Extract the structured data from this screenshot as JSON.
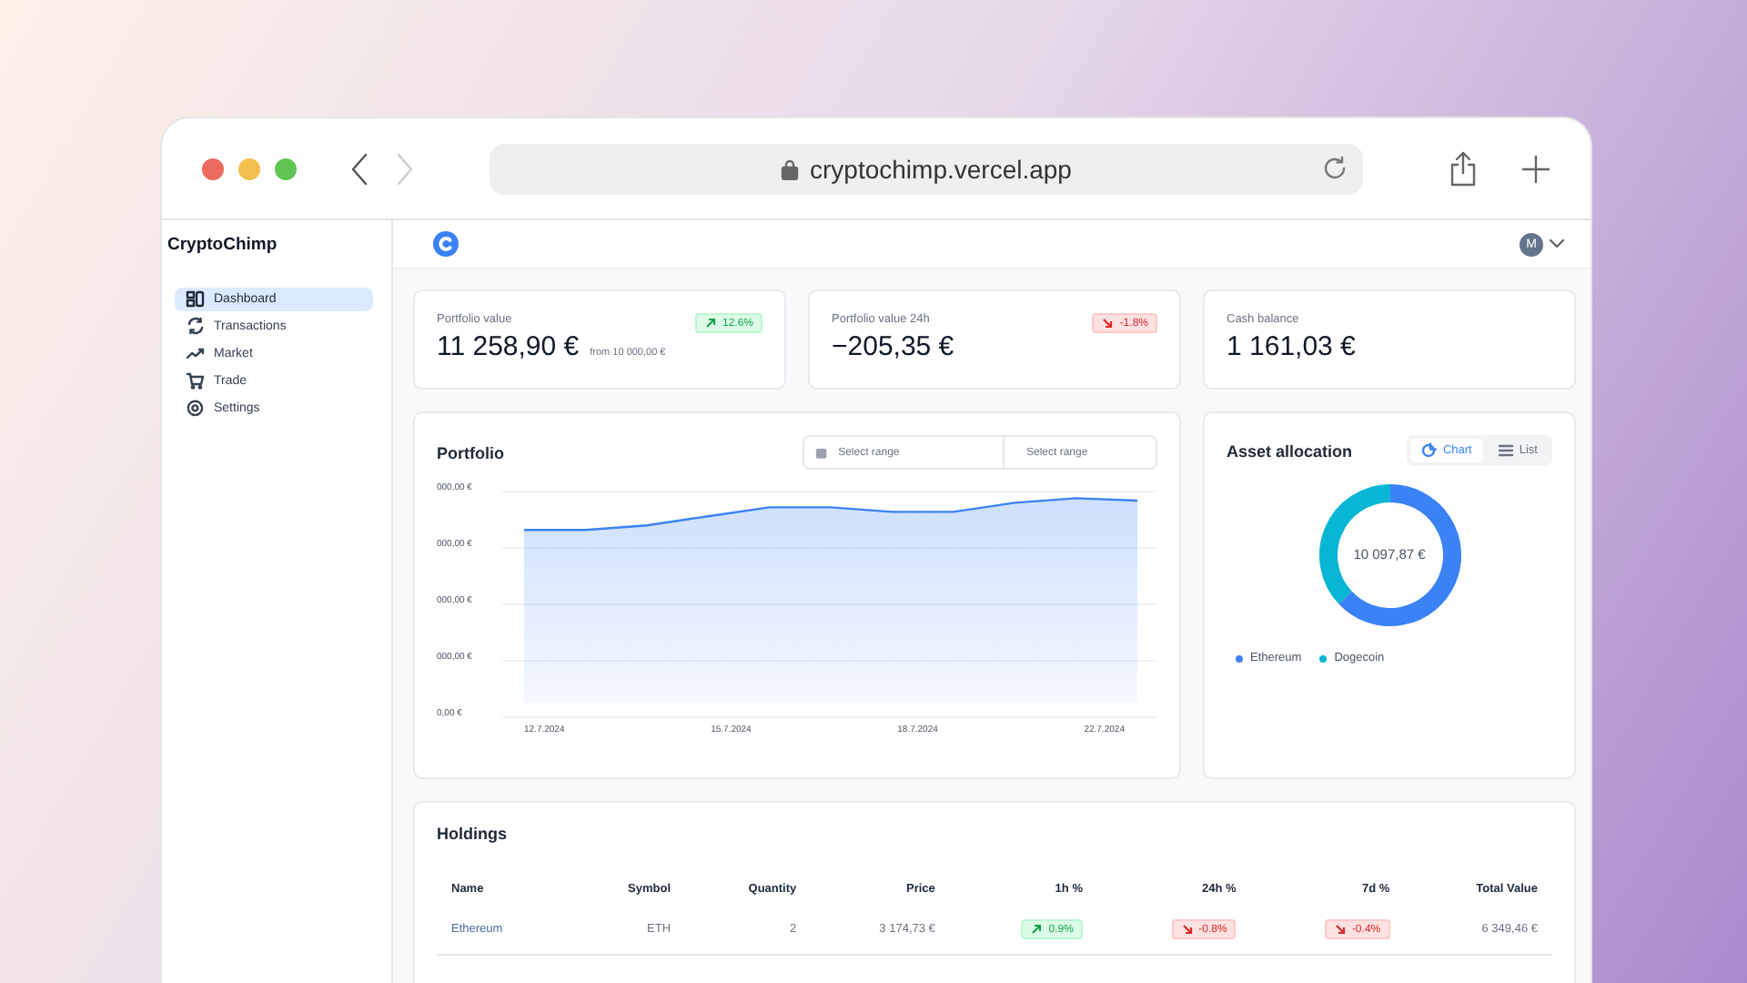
{
  "browser": {
    "url": "cryptochimp.vercel.app"
  },
  "sidebar": {
    "brand": "CryptoChimp",
    "items": [
      {
        "label": "Dashboard",
        "kind": "dashboard",
        "selected": true
      },
      {
        "label": "Transactions",
        "kind": "transactions",
        "selected": false
      },
      {
        "label": "Market",
        "kind": "market",
        "selected": false
      },
      {
        "label": "Trade",
        "kind": "trade",
        "selected": false
      },
      {
        "label": "Settings",
        "kind": "settings",
        "selected": false
      }
    ]
  },
  "header": {
    "avatar": "M"
  },
  "stats": [
    {
      "label": "Portfolio value",
      "value": "11 258,90 €",
      "note": "from 10 000,00 €",
      "change": {
        "text": "12.6%",
        "rising": true
      }
    },
    {
      "label": "Portfolio value 24h",
      "value": "−205,35 €",
      "change": {
        "text": "-1.8%",
        "rising": false
      }
    },
    {
      "label": "Cash balance",
      "value": "1 161,03 €"
    }
  ],
  "portfolio": {
    "title": "Portfolio",
    "range_start": {
      "placeholder": "Select range"
    },
    "range_end": {
      "placeholder": "Select range"
    },
    "y_ticks": [
      "000,00 €",
      "000,00 €",
      "000,00 €",
      "000,00 €",
      "0,00 €"
    ],
    "x_ticks": [
      "12.7.2024",
      "15.7.2024",
      "18.7.2024",
      "22.7.2024"
    ]
  },
  "allocation": {
    "title": "Asset allocation",
    "views": [
      {
        "label": "Chart",
        "kind": "chart",
        "selected": true
      },
      {
        "label": "List",
        "kind": "list",
        "selected": false
      }
    ],
    "total": "10 097,87 €",
    "assets": [
      {
        "name": "Ethereum",
        "color": "#3b82f6"
      },
      {
        "name": "Dogecoin",
        "color": "#06b6d4"
      }
    ]
  },
  "holdings": {
    "title": "Holdings",
    "columns": [
      "Name",
      "Symbol",
      "Quantity",
      "Price",
      "1h %",
      "24h %",
      "7d %",
      "Total Value"
    ],
    "rows": [
      {
        "name": "Ethereum",
        "symbol": "ETH",
        "quantity": "2",
        "price": "3 174,73 €",
        "changes": [
          {
            "text": "0.9%",
            "rising": true
          },
          {
            "text": "-0.8%",
            "rising": false
          },
          {
            "text": "-0.4%",
            "rising": false
          }
        ],
        "total": "6 349,46 €"
      }
    ]
  }
}
